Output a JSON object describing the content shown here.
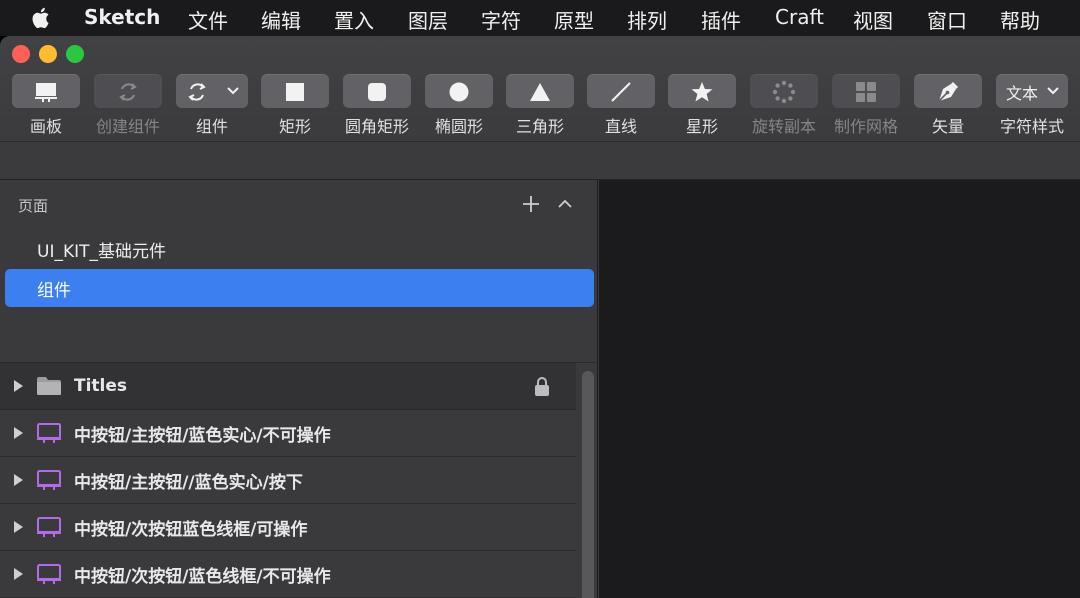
{
  "menubar": {
    "app_name": "Sketch",
    "items": [
      "文件",
      "编辑",
      "置入",
      "图层",
      "字符",
      "原型",
      "排列",
      "插件",
      "Craft",
      "视图",
      "窗口",
      "帮助"
    ]
  },
  "toolbar": {
    "tools": [
      {
        "label": "画板",
        "icon": "artboard-icon",
        "enabled": true
      },
      {
        "label": "创建组件",
        "icon": "create-symbol-icon",
        "enabled": false
      },
      {
        "label": "组件",
        "icon": "symbol-icon",
        "enabled": true
      },
      {
        "label": "矩形",
        "icon": "rectangle-icon",
        "enabled": true
      },
      {
        "label": "圆角矩形",
        "icon": "rounded-rectangle-icon",
        "enabled": true
      },
      {
        "label": "椭圆形",
        "icon": "oval-icon",
        "enabled": true
      },
      {
        "label": "三角形",
        "icon": "triangle-icon",
        "enabled": true
      },
      {
        "label": "直线",
        "icon": "line-icon",
        "enabled": true
      },
      {
        "label": "星形",
        "icon": "star-icon",
        "enabled": true
      },
      {
        "label": "旋转副本",
        "icon": "rotate-copies-icon",
        "enabled": false
      },
      {
        "label": "制作网格",
        "icon": "make-grid-icon",
        "enabled": false
      },
      {
        "label": "矢量",
        "icon": "vector-pen-icon",
        "enabled": true
      },
      {
        "label": "字符样式",
        "icon": "text-style-icon",
        "enabled": true,
        "button_text": "文本"
      }
    ]
  },
  "pages": {
    "title": "页面",
    "items": [
      {
        "label": "UI_KIT_基础元件",
        "selected": false
      },
      {
        "label": "组件",
        "selected": true
      }
    ]
  },
  "layers": [
    {
      "name": "Titles",
      "type": "group",
      "locked": true
    },
    {
      "name": "中按钮/主按钮/蓝色实心/不可操作",
      "type": "symbol",
      "locked": false
    },
    {
      "name": "中按钮/主按钮//蓝色实心/按下",
      "type": "symbol",
      "locked": false
    },
    {
      "name": "中按钮/次按钮蓝色线框/可操作",
      "type": "symbol",
      "locked": false
    },
    {
      "name": "中按钮/次按钮/蓝色线框/不可操作",
      "type": "symbol",
      "locked": false
    }
  ],
  "colors": {
    "selection_accent": "#3b7ff0",
    "symbol_icon": "#b36be8",
    "traffic_close": "#ff5f57",
    "traffic_minimize": "#febc2e",
    "traffic_zoom": "#28c840"
  }
}
